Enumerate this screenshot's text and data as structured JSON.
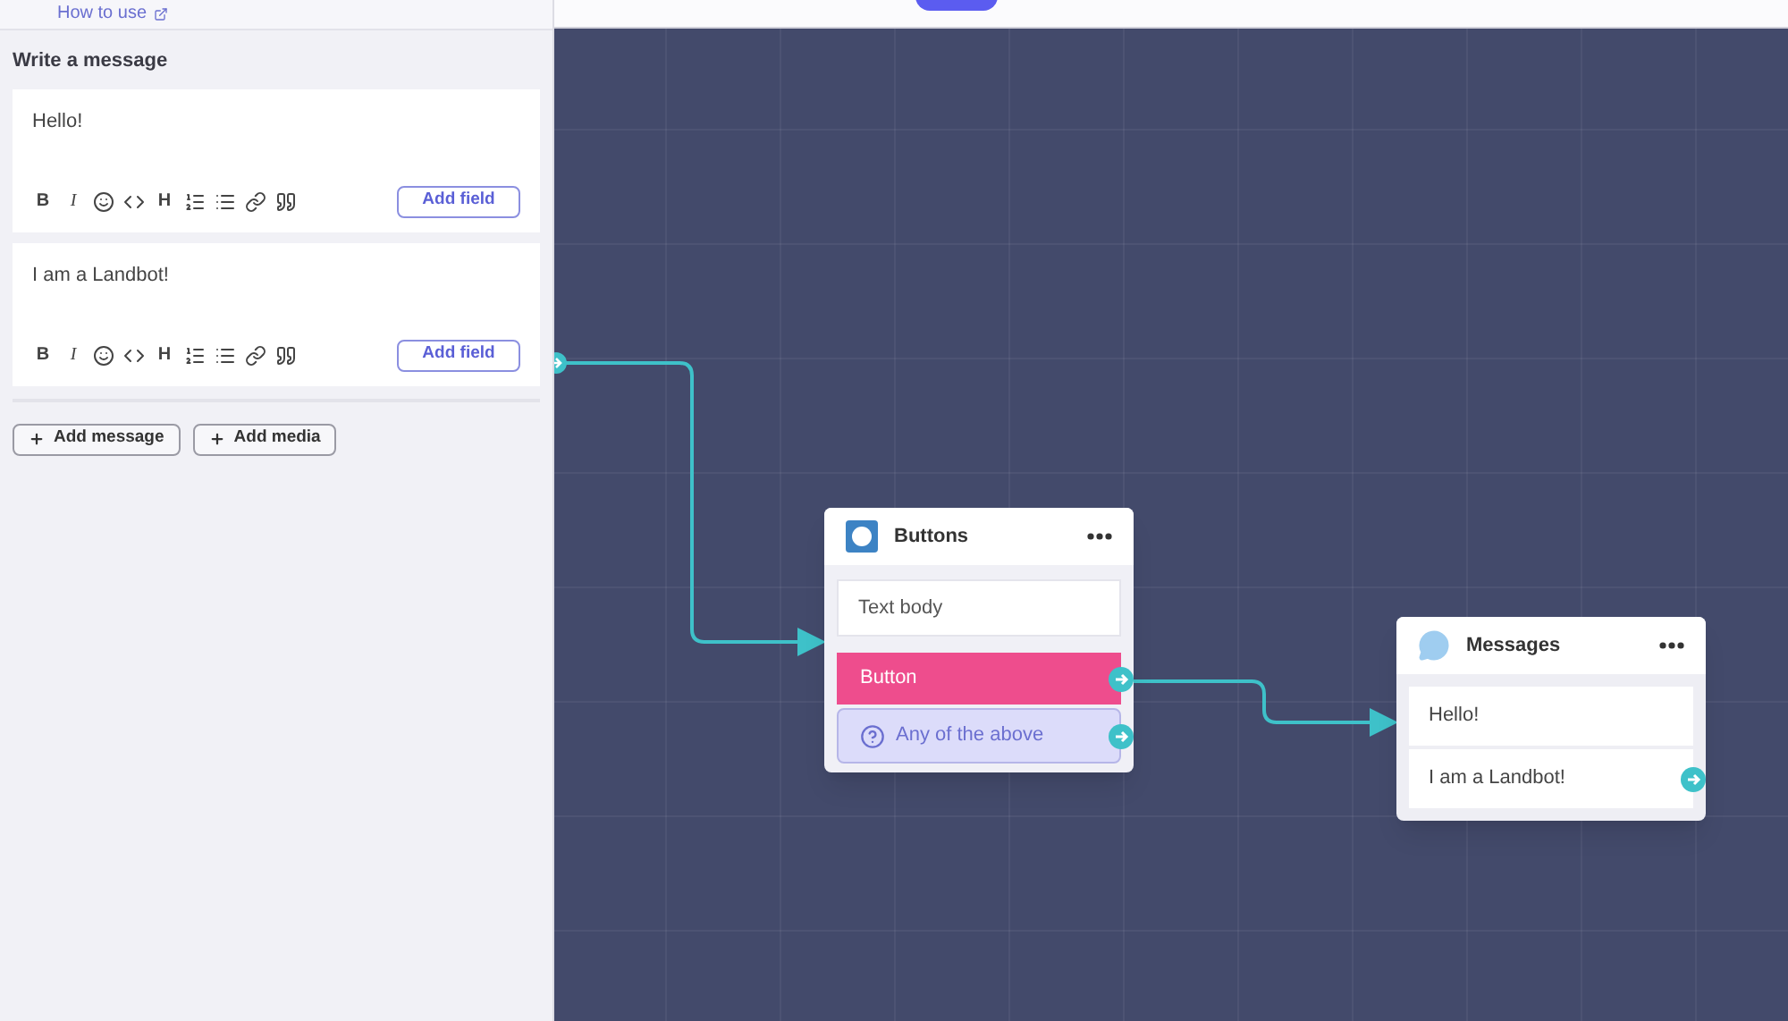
{
  "sidebar": {
    "help_link": "How to use",
    "section_title": "Write a message",
    "messages": [
      {
        "text": "Hello!",
        "add_field": "Add field",
        "toolbar": [
          {
            "kind": "text",
            "label": "B"
          },
          {
            "kind": "italic",
            "label": "I"
          },
          {
            "kind": "emoji"
          },
          {
            "kind": "code"
          },
          {
            "kind": "text",
            "label": "H"
          },
          {
            "kind": "ordered-list"
          },
          {
            "kind": "bullet-list"
          },
          {
            "kind": "link"
          },
          {
            "kind": "quote"
          }
        ]
      },
      {
        "text": "I am a Landbot!",
        "add_field": "Add field",
        "toolbar": [
          {
            "kind": "text",
            "label": "B"
          },
          {
            "kind": "italic",
            "label": "I"
          },
          {
            "kind": "emoji"
          },
          {
            "kind": "code"
          },
          {
            "kind": "text",
            "label": "H"
          },
          {
            "kind": "ordered-list"
          },
          {
            "kind": "bullet-list"
          },
          {
            "kind": "link"
          },
          {
            "kind": "quote"
          }
        ]
      }
    ],
    "actions": [
      "Add message",
      "Add media"
    ]
  },
  "canvas": {
    "buttons_node": {
      "title": "Buttons",
      "text_body": "Text body",
      "buttons": [
        {
          "kind": "button",
          "label": "Button"
        },
        {
          "kind": "fallback",
          "label": "Any of the above"
        }
      ]
    },
    "messages_node": {
      "title": "Messages",
      "messages": [
        "Hello!",
        "I am a Landbot!"
      ]
    }
  }
}
